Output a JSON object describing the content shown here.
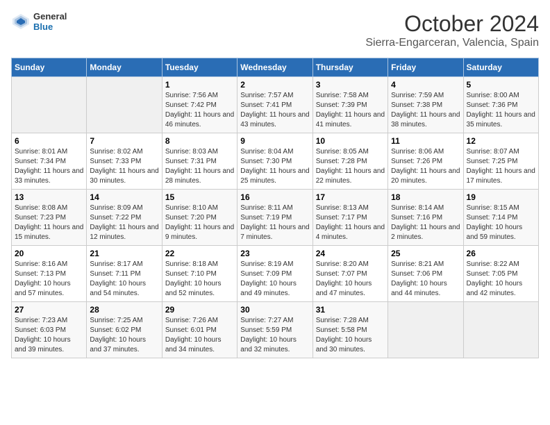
{
  "logo": {
    "general": "General",
    "blue": "Blue"
  },
  "title": "October 2024",
  "subtitle": "Sierra-Engarceran, Valencia, Spain",
  "weekdays": [
    "Sunday",
    "Monday",
    "Tuesday",
    "Wednesday",
    "Thursday",
    "Friday",
    "Saturday"
  ],
  "weeks": [
    [
      {
        "day": "",
        "info": ""
      },
      {
        "day": "",
        "info": ""
      },
      {
        "day": "1",
        "info": "Sunrise: 7:56 AM\nSunset: 7:42 PM\nDaylight: 11 hours and 46 minutes."
      },
      {
        "day": "2",
        "info": "Sunrise: 7:57 AM\nSunset: 7:41 PM\nDaylight: 11 hours and 43 minutes."
      },
      {
        "day": "3",
        "info": "Sunrise: 7:58 AM\nSunset: 7:39 PM\nDaylight: 11 hours and 41 minutes."
      },
      {
        "day": "4",
        "info": "Sunrise: 7:59 AM\nSunset: 7:38 PM\nDaylight: 11 hours and 38 minutes."
      },
      {
        "day": "5",
        "info": "Sunrise: 8:00 AM\nSunset: 7:36 PM\nDaylight: 11 hours and 35 minutes."
      }
    ],
    [
      {
        "day": "6",
        "info": "Sunrise: 8:01 AM\nSunset: 7:34 PM\nDaylight: 11 hours and 33 minutes."
      },
      {
        "day": "7",
        "info": "Sunrise: 8:02 AM\nSunset: 7:33 PM\nDaylight: 11 hours and 30 minutes."
      },
      {
        "day": "8",
        "info": "Sunrise: 8:03 AM\nSunset: 7:31 PM\nDaylight: 11 hours and 28 minutes."
      },
      {
        "day": "9",
        "info": "Sunrise: 8:04 AM\nSunset: 7:30 PM\nDaylight: 11 hours and 25 minutes."
      },
      {
        "day": "10",
        "info": "Sunrise: 8:05 AM\nSunset: 7:28 PM\nDaylight: 11 hours and 22 minutes."
      },
      {
        "day": "11",
        "info": "Sunrise: 8:06 AM\nSunset: 7:26 PM\nDaylight: 11 hours and 20 minutes."
      },
      {
        "day": "12",
        "info": "Sunrise: 8:07 AM\nSunset: 7:25 PM\nDaylight: 11 hours and 17 minutes."
      }
    ],
    [
      {
        "day": "13",
        "info": "Sunrise: 8:08 AM\nSunset: 7:23 PM\nDaylight: 11 hours and 15 minutes."
      },
      {
        "day": "14",
        "info": "Sunrise: 8:09 AM\nSunset: 7:22 PM\nDaylight: 11 hours and 12 minutes."
      },
      {
        "day": "15",
        "info": "Sunrise: 8:10 AM\nSunset: 7:20 PM\nDaylight: 11 hours and 9 minutes."
      },
      {
        "day": "16",
        "info": "Sunrise: 8:11 AM\nSunset: 7:19 PM\nDaylight: 11 hours and 7 minutes."
      },
      {
        "day": "17",
        "info": "Sunrise: 8:13 AM\nSunset: 7:17 PM\nDaylight: 11 hours and 4 minutes."
      },
      {
        "day": "18",
        "info": "Sunrise: 8:14 AM\nSunset: 7:16 PM\nDaylight: 11 hours and 2 minutes."
      },
      {
        "day": "19",
        "info": "Sunrise: 8:15 AM\nSunset: 7:14 PM\nDaylight: 10 hours and 59 minutes."
      }
    ],
    [
      {
        "day": "20",
        "info": "Sunrise: 8:16 AM\nSunset: 7:13 PM\nDaylight: 10 hours and 57 minutes."
      },
      {
        "day": "21",
        "info": "Sunrise: 8:17 AM\nSunset: 7:11 PM\nDaylight: 10 hours and 54 minutes."
      },
      {
        "day": "22",
        "info": "Sunrise: 8:18 AM\nSunset: 7:10 PM\nDaylight: 10 hours and 52 minutes."
      },
      {
        "day": "23",
        "info": "Sunrise: 8:19 AM\nSunset: 7:09 PM\nDaylight: 10 hours and 49 minutes."
      },
      {
        "day": "24",
        "info": "Sunrise: 8:20 AM\nSunset: 7:07 PM\nDaylight: 10 hours and 47 minutes."
      },
      {
        "day": "25",
        "info": "Sunrise: 8:21 AM\nSunset: 7:06 PM\nDaylight: 10 hours and 44 minutes."
      },
      {
        "day": "26",
        "info": "Sunrise: 8:22 AM\nSunset: 7:05 PM\nDaylight: 10 hours and 42 minutes."
      }
    ],
    [
      {
        "day": "27",
        "info": "Sunrise: 7:23 AM\nSunset: 6:03 PM\nDaylight: 10 hours and 39 minutes."
      },
      {
        "day": "28",
        "info": "Sunrise: 7:25 AM\nSunset: 6:02 PM\nDaylight: 10 hours and 37 minutes."
      },
      {
        "day": "29",
        "info": "Sunrise: 7:26 AM\nSunset: 6:01 PM\nDaylight: 10 hours and 34 minutes."
      },
      {
        "day": "30",
        "info": "Sunrise: 7:27 AM\nSunset: 5:59 PM\nDaylight: 10 hours and 32 minutes."
      },
      {
        "day": "31",
        "info": "Sunrise: 7:28 AM\nSunset: 5:58 PM\nDaylight: 10 hours and 30 minutes."
      },
      {
        "day": "",
        "info": ""
      },
      {
        "day": "",
        "info": ""
      }
    ]
  ]
}
